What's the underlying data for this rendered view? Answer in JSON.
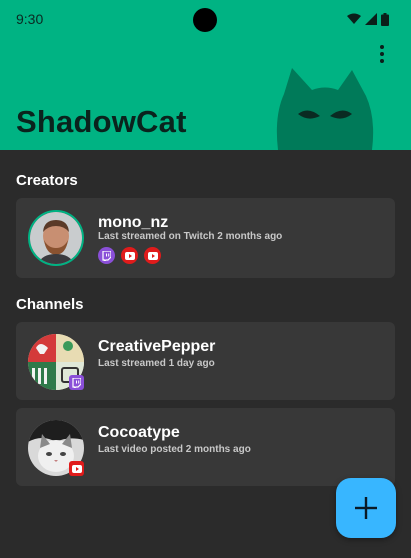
{
  "status_bar": {
    "time": "9:30"
  },
  "app": {
    "title": "ShadowCat"
  },
  "colors": {
    "accent": "#00b383",
    "fab": "#38b6ff",
    "twitch": "#8a4fd8",
    "youtube": "#e01b1b"
  },
  "sections": {
    "creators": {
      "title": "Creators",
      "items": [
        {
          "name": "mono_nz",
          "subtitle": "Last streamed on Twitch 2 months ago",
          "platforms": [
            "twitch-icon",
            "youtube-icon",
            "youtube-icon"
          ]
        }
      ]
    },
    "channels": {
      "title": "Channels",
      "items": [
        {
          "name": "CreativePepper",
          "subtitle": "Last streamed 1 day ago",
          "platform": "twitch-icon"
        },
        {
          "name": "Cocoatype",
          "subtitle": "Last video posted 2 months ago",
          "platform": "youtube-icon"
        }
      ]
    }
  },
  "fab": {
    "icon": "plus-icon"
  },
  "menu": {
    "icon": "more-vert-icon"
  }
}
